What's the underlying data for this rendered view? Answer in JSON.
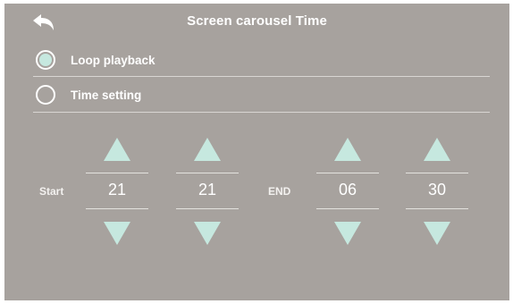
{
  "header": {
    "title": "Screen carousel Time",
    "back_icon": "back-arrow-icon"
  },
  "options": [
    {
      "label": "Loop playback",
      "selected": true
    },
    {
      "label": "Time setting",
      "selected": false
    }
  ],
  "time": {
    "start_label": "Start",
    "end_label": "END",
    "start_hour": "21",
    "start_minute": "21",
    "end_hour": "06",
    "end_minute": "30"
  },
  "colors": {
    "background": "#a7a29e",
    "accent": "#c6e8df",
    "text": "#ffffff"
  }
}
